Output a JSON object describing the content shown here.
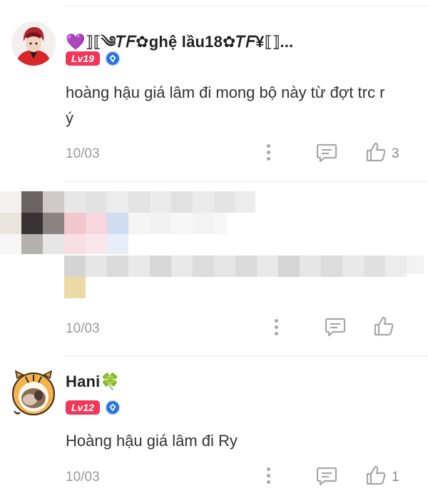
{
  "comments": [
    {
      "username": "💜⟧⟦༄𝑇𝐹✿ghệ lầu18✿𝑇𝐹¥⟦⟧...",
      "level": "Lv19",
      "text_line1": "hoàng hậu giá lâm đi mong bộ này từ đợt trc r",
      "text_line2": "ý",
      "date": "10/03",
      "like_count": "3"
    },
    {
      "date": "10/03"
    },
    {
      "username": "Hani🍀",
      "level": "Lv12",
      "text_line1": "Hoàng hậu giá lâm đi Ry",
      "date": "10/03",
      "like_count": "1"
    }
  ],
  "colors": {
    "level_badge": "#f2365a",
    "verified_badge": "#2b74d8",
    "icon_gray": "#a7a7a7"
  },
  "icons": {
    "more": "vertical-dots-icon",
    "reply": "comment-bubble-icon",
    "like": "thumbs-up-icon",
    "verified": "blue-diamond-badge-icon"
  }
}
